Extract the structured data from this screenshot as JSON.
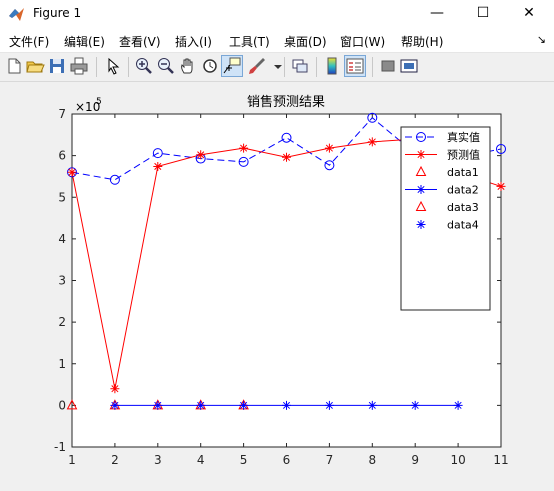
{
  "window": {
    "title": "Figure 1",
    "minimize_glyph": "—",
    "maximize_glyph": "☐",
    "close_glyph": "✕"
  },
  "menu": [
    "文件(F)",
    "编辑(E)",
    "查看(V)",
    "插入(I)",
    "工具(T)",
    "桌面(D)",
    "窗口(W)",
    "帮助(H)"
  ],
  "menu_dock_glyph": "↘",
  "toolbar": [
    "new-figure-icon",
    "open-file-icon",
    "save-icon",
    "print-icon",
    "pointer-icon",
    "zoom-in-icon",
    "zoom-out-icon",
    "pan-icon",
    "rotate-3d-icon",
    "data-cursor-icon",
    "brush-icon",
    "link-plot-icon",
    "colorbar-icon",
    "legend-icon",
    "hide-plot-tools-icon",
    "show-plot-tools-icon"
  ],
  "chart_data": {
    "type": "line",
    "title": "销售预测结果",
    "y_exponent_label": "×10",
    "y_exponent_power": "5",
    "xlim": [
      1,
      11
    ],
    "ylim": [
      -1,
      7
    ],
    "x_ticks": [
      "1",
      "2",
      "3",
      "4",
      "5",
      "6",
      "7",
      "8",
      "9",
      "10",
      "11"
    ],
    "y_ticks": [
      "-1",
      "0",
      "1",
      "2",
      "3",
      "4",
      "5",
      "6",
      "7"
    ],
    "series": [
      {
        "name": "真实值",
        "style": "dashed-circle",
        "color": "#0000ff",
        "x": [
          1,
          2,
          3,
          4,
          5,
          6,
          7,
          8,
          9,
          10,
          11
        ],
        "y": [
          5.6,
          5.42,
          6.06,
          5.93,
          5.85,
          6.43,
          5.77,
          6.91,
          6.05,
          5.95,
          6.16
        ]
      },
      {
        "name": "预测值",
        "style": "solid-star",
        "color": "#ff0000",
        "x": [
          1,
          2,
          3,
          4,
          5,
          6,
          7,
          8,
          9,
          10,
          11
        ],
        "y": [
          5.6,
          0.4,
          5.74,
          6.02,
          6.18,
          5.96,
          6.18,
          6.33,
          6.4,
          5.6,
          5.26
        ]
      },
      {
        "name": "data1",
        "style": "triangle",
        "color": "#ff0000",
        "x": [
          1,
          2,
          3,
          4,
          5
        ],
        "y": [
          0,
          0,
          0,
          0,
          0
        ]
      },
      {
        "name": "data2",
        "style": "solid-star",
        "color": "#0000ff",
        "x": [
          2,
          3,
          4,
          5,
          6,
          7,
          8,
          9,
          10
        ],
        "y": [
          0,
          0,
          0,
          0,
          0,
          0,
          0,
          0,
          0
        ]
      },
      {
        "name": "data3",
        "style": "triangle",
        "color": "#ff0000",
        "x": [],
        "y": []
      },
      {
        "name": "data4",
        "style": "star",
        "color": "#0000ff",
        "x": [],
        "y": []
      }
    ],
    "legend_position": "top-right",
    "grid": false
  }
}
